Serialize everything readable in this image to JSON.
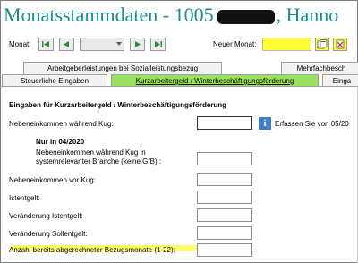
{
  "window": {
    "title_prefix": "Monatsstammdaten - 1005",
    "title_suffix": ", Hanno"
  },
  "toolbar": {
    "monat_label": "Monat:",
    "neuer_monat_label": "Neuer Monat:",
    "neuer_monat_value": "",
    "monat_value": ""
  },
  "tabs": {
    "row1": [
      {
        "label": "Arbeitgeberleistungen bei Sozialleistungsbezug"
      },
      {
        "label": "Mehrfachbesch"
      }
    ],
    "row2": [
      {
        "label": "Steuerliche Eingaben"
      },
      {
        "label": "Kurzarbeitergeld / Winterbeschäftigungsförderung"
      },
      {
        "label": "Einga"
      }
    ]
  },
  "form": {
    "heading": "Eingaben für Kurzarbeitergeld / Winterbeschäftigungsförderung",
    "info_icon_glyph": "i",
    "info_text": "Erfassen Sie von 05/20",
    "subheading": "Nur in 04/2020",
    "fields": [
      {
        "label": "Nebeneinkommen während Kug:",
        "value": ""
      },
      {
        "label_line1": "Nebeneinkommen während Kug in",
        "label_line2": "systemrelevanter Branche (keine GfB) :",
        "value": ""
      },
      {
        "label": "Nebeneinkommen vor Kug:",
        "value": ""
      },
      {
        "label": "Istentgelt:",
        "value": ""
      },
      {
        "label": "Veränderung Istentgelt:",
        "value": ""
      },
      {
        "label": "Veränderung Sollentgelt:",
        "value": ""
      },
      {
        "label": "Anzahl bereits abgerechneter Bezugsmonate (1-22):",
        "value": ""
      }
    ]
  },
  "colors": {
    "title": "#1c8a8a",
    "active_tab": "#99e05d",
    "highlight": "#ffff33",
    "info_icon": "#3f7fbf"
  },
  "icons": [
    "first-icon",
    "prev-icon",
    "next-icon",
    "last-icon",
    "new-month-icon",
    "delete-month-icon",
    "info-icon"
  ]
}
